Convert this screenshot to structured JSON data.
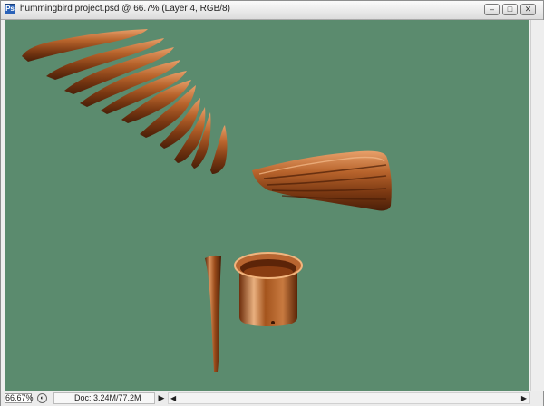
{
  "window": {
    "title": "hummingbird project.psd @ 66.7% (Layer 4, RGB/8)",
    "minimize_icon": "minimize-icon",
    "maximize_icon": "maximize-icon",
    "close_icon": "close-icon"
  },
  "canvas": {
    "background_color": "#5b8b6e",
    "object_color": "#a0521f"
  },
  "statusbar": {
    "zoom": "66.67%",
    "doc_info": "Doc: 3.24M/77.2M",
    "menu_arrow": "▶",
    "scroll_left": "◀",
    "scroll_right": "▶"
  }
}
